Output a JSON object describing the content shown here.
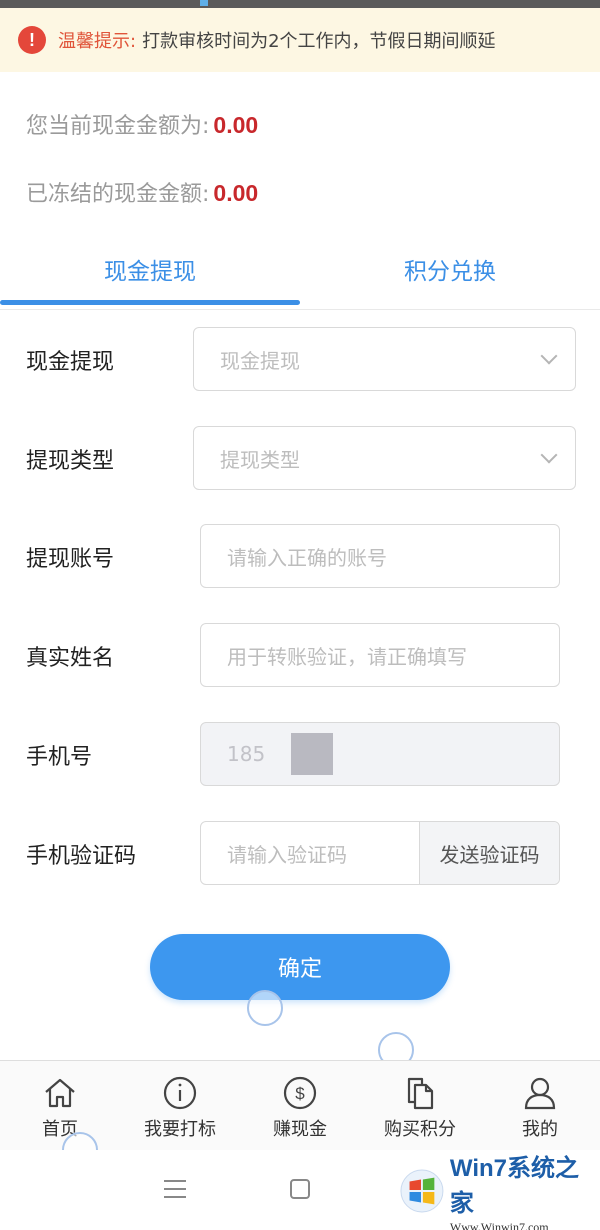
{
  "notice": {
    "label": "温馨提示:",
    "text": "打款审核时间为2个工作内，节假日期间顺延",
    "icon": "exclamation-icon"
  },
  "balance": {
    "current_label": "您当前现金金额为:",
    "current_value": "0.00",
    "frozen_label": "已冻结的现金金额:",
    "frozen_value": "0.00"
  },
  "tabs": [
    {
      "label": "现金提现",
      "active": true
    },
    {
      "label": "积分兑换",
      "active": false
    }
  ],
  "form": {
    "withdraw_method": {
      "label": "现金提现",
      "placeholder": "现金提现"
    },
    "withdraw_type": {
      "label": "提现类型",
      "placeholder": "提现类型"
    },
    "account": {
      "label": "提现账号",
      "placeholder": "请输入正确的账号"
    },
    "real_name": {
      "label": "真实姓名",
      "placeholder": "用于转账验证，请正确填写"
    },
    "phone": {
      "label": "手机号",
      "value": "185"
    },
    "code": {
      "label": "手机验证码",
      "placeholder": "请输入验证码",
      "send_label": "发送验证码"
    }
  },
  "confirm_label": "确定",
  "bottom_nav": [
    {
      "label": "首页",
      "icon": "home-icon"
    },
    {
      "label": "我要打标",
      "icon": "info-icon"
    },
    {
      "label": "赚现金",
      "icon": "dollar-icon"
    },
    {
      "label": "购买积分",
      "icon": "documents-icon"
    },
    {
      "label": "我的",
      "icon": "user-icon"
    }
  ],
  "watermark": {
    "main": "Win7系统之家",
    "url": "Www.Winwin7.com"
  },
  "colors": {
    "accent": "#3b8fe6",
    "amount": "#c8282c",
    "notice_bg": "#fdf7e3",
    "notice_label": "#e0553a"
  }
}
